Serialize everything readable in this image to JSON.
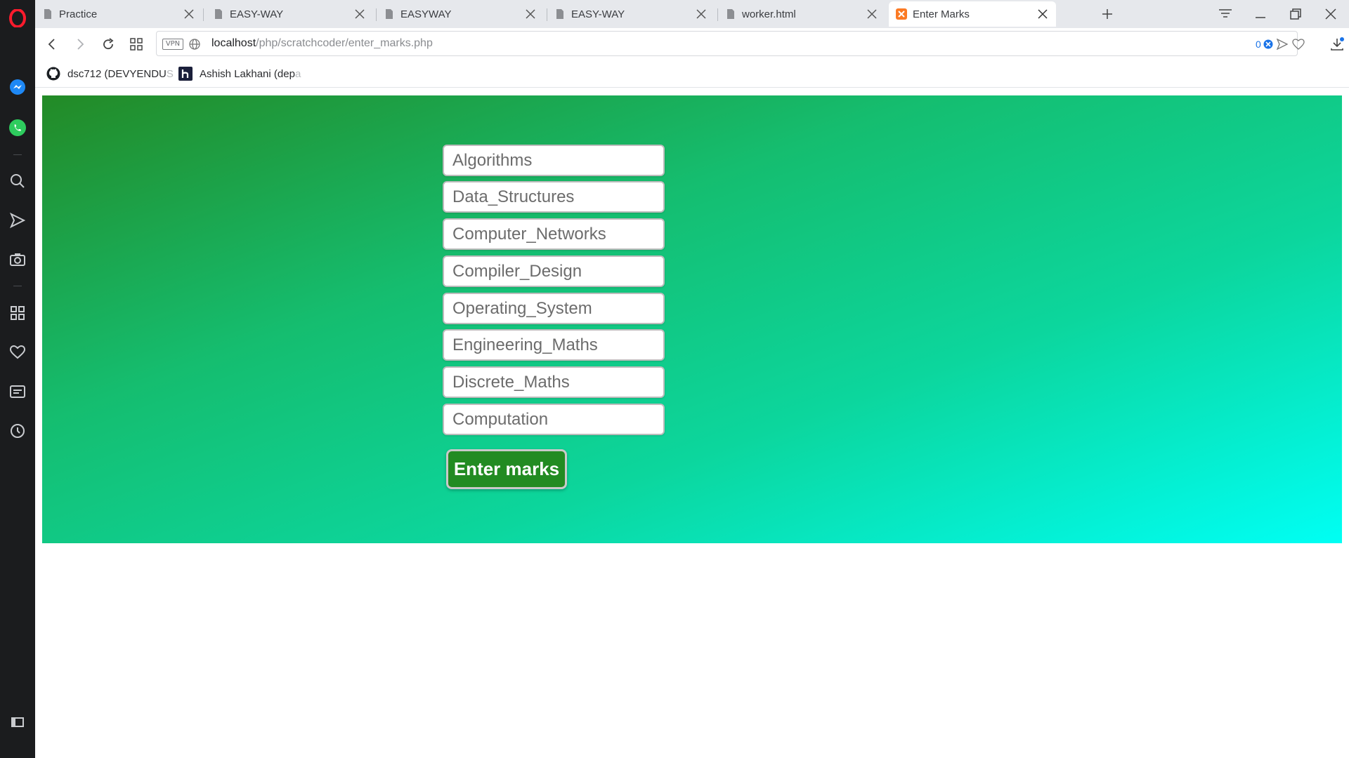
{
  "sidebar": {
    "items": [
      "opera-logo",
      "messenger",
      "whatsapp",
      "search",
      "send",
      "camera",
      "workspaces",
      "favorites",
      "news",
      "history",
      "sidebar-toggle"
    ]
  },
  "tabs": [
    {
      "title": "Practice",
      "active": false
    },
    {
      "title": "EASY-WAY",
      "active": false
    },
    {
      "title": "EASYWAY",
      "active": false
    },
    {
      "title": "EASY-WAY",
      "active": false
    },
    {
      "title": "worker.html",
      "active": false
    },
    {
      "title": "Enter Marks",
      "active": true
    }
  ],
  "address_bar": {
    "vpn_label": "VPN",
    "host": "localhost",
    "path": "/php/scratchcoder/enter_marks.php",
    "blocked_count": "0"
  },
  "bookmarks": [
    {
      "label": "dsc712 (DEVYENDU",
      "fade": " S",
      "icon": "github-icon"
    },
    {
      "label": "Ashish Lakhani (dep",
      "fade": "a",
      "icon": "hashnode-icon"
    }
  ],
  "form": {
    "subjects": [
      "Algorithms",
      "Data_Structures",
      "Computer_Networks",
      "Compiler_Design",
      "Operating_System",
      "Engineering_Maths",
      "Discrete_Maths",
      "Computation"
    ],
    "submit_label": "Enter marks"
  },
  "colors": {
    "gradient_start": "#238a26",
    "gradient_end": "#00fff4",
    "button_bg": "#228b22",
    "opera_red": "#ff1b2d"
  }
}
